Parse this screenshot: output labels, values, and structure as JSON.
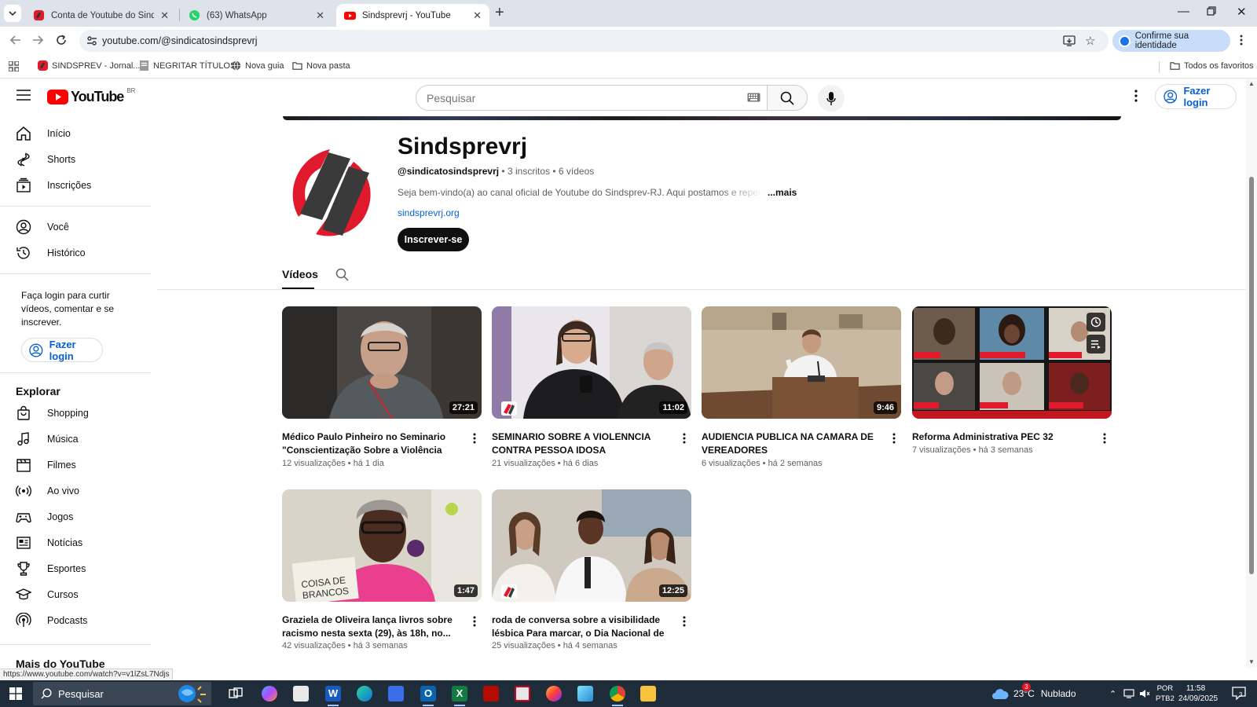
{
  "browser": {
    "tabs": [
      {
        "title": "Conta de Youtube do Sindsprev",
        "active": false
      },
      {
        "title": "(63) WhatsApp",
        "active": false
      },
      {
        "title": "Sindsprevrj - YouTube",
        "active": true
      }
    ],
    "url": "youtube.com/@sindicatosindsprevrj",
    "identity_label": "Confirme sua identidade",
    "bookmarks": [
      {
        "label": "SINDSPREV - Jornal..."
      },
      {
        "label": "NEGRITAR TÍTULOS"
      },
      {
        "label": "Nova guia"
      },
      {
        "label": "Nova pasta"
      }
    ],
    "all_bookmarks": "Todos os favoritos",
    "status_url": "https://www.youtube.com/watch?v=v1lZsL7Ndjs"
  },
  "youtube": {
    "logo_text": "YouTube",
    "region": "BR",
    "search_placeholder": "Pesquisar",
    "login_label": "Fazer login"
  },
  "sidebar": {
    "main": [
      {
        "label": "Início",
        "icon": "home-icon"
      },
      {
        "label": "Shorts",
        "icon": "shorts-icon"
      },
      {
        "label": "Inscrições",
        "icon": "subscriptions-icon"
      }
    ],
    "you": [
      {
        "label": "Você",
        "icon": "you-icon"
      },
      {
        "label": "Histórico",
        "icon": "history-icon"
      }
    ],
    "login_note": "Faça login para curtir vídeos, comentar e se inscrever.",
    "login_label": "Fazer login",
    "explore_title": "Explorar",
    "explore": [
      {
        "label": "Shopping",
        "icon": "shopping-bag-icon"
      },
      {
        "label": "Música",
        "icon": "music-note-icon"
      },
      {
        "label": "Filmes",
        "icon": "clapperboard-icon"
      },
      {
        "label": "Ao vivo",
        "icon": "live-icon"
      },
      {
        "label": "Jogos",
        "icon": "gamepad-icon"
      },
      {
        "label": "Notícias",
        "icon": "newspaper-icon"
      },
      {
        "label": "Esportes",
        "icon": "trophy-icon"
      },
      {
        "label": "Cursos",
        "icon": "graduation-cap-icon"
      },
      {
        "label": "Podcasts",
        "icon": "podcast-icon"
      }
    ],
    "more_title": "Mais do YouTube"
  },
  "channel": {
    "name": "Sindsprevrj",
    "handle": "@sindicatosindsprevrj",
    "subscribers": "3 inscritos",
    "video_count": "6 vídeos",
    "meta_sep": "•",
    "description": "Seja bem-vindo(a) ao canal oficial de Youtube do Sindsprev-RJ. Aqui postamos e repercutimos",
    "more_label": "...mais",
    "link": "sindsprevrj.org",
    "subscribe_label": "Inscrever-se",
    "tab_videos": "Vídeos",
    "brand_red": "#e0192d"
  },
  "videos": [
    {
      "title": "Médico Paulo Pinheiro no Seminario \"Conscientização Sobre a Violência Contra ...",
      "duration": "27:21",
      "views": "12 visualizações",
      "age": "há 1 dia"
    },
    {
      "title": "SEMINARIO SOBRE A VIOLENNCIA CONTRA PESSOA IDOSA",
      "duration": "11:02",
      "views": "21 visualizações",
      "age": "há 6 dias"
    },
    {
      "title": "AUDIENCIA PUBLICA NA CAMARA DE VEREADORES",
      "duration": "9:46",
      "views": "6 visualizações",
      "age": "há 2 semanas"
    },
    {
      "title": "Reforma Administrativa PEC 32",
      "duration": "",
      "views": "7 visualizações",
      "age": "há 3 semanas"
    },
    {
      "title": "Graziela de Oliveira lança livros sobre racismo nesta sexta (29), às 18h, no...",
      "duration": "1:47",
      "views": "42 visualizações",
      "age": "há 3 semanas"
    },
    {
      "title": "roda de conversa sobre a visibilidade lésbica Para marcar, o Dia Nacional de Visibilidade...",
      "duration": "12:25",
      "views": "25 visualizações",
      "age": "há 4 semanas"
    }
  ],
  "taskbar": {
    "search_label": "Pesquisar",
    "weather": "23°C",
    "weather_desc": "Nublado",
    "lang": "POR",
    "lang_sub": "PTB2",
    "time": "11:58",
    "date": "24/09/2025",
    "notif_count": "3",
    "notif_center_count": "3"
  }
}
